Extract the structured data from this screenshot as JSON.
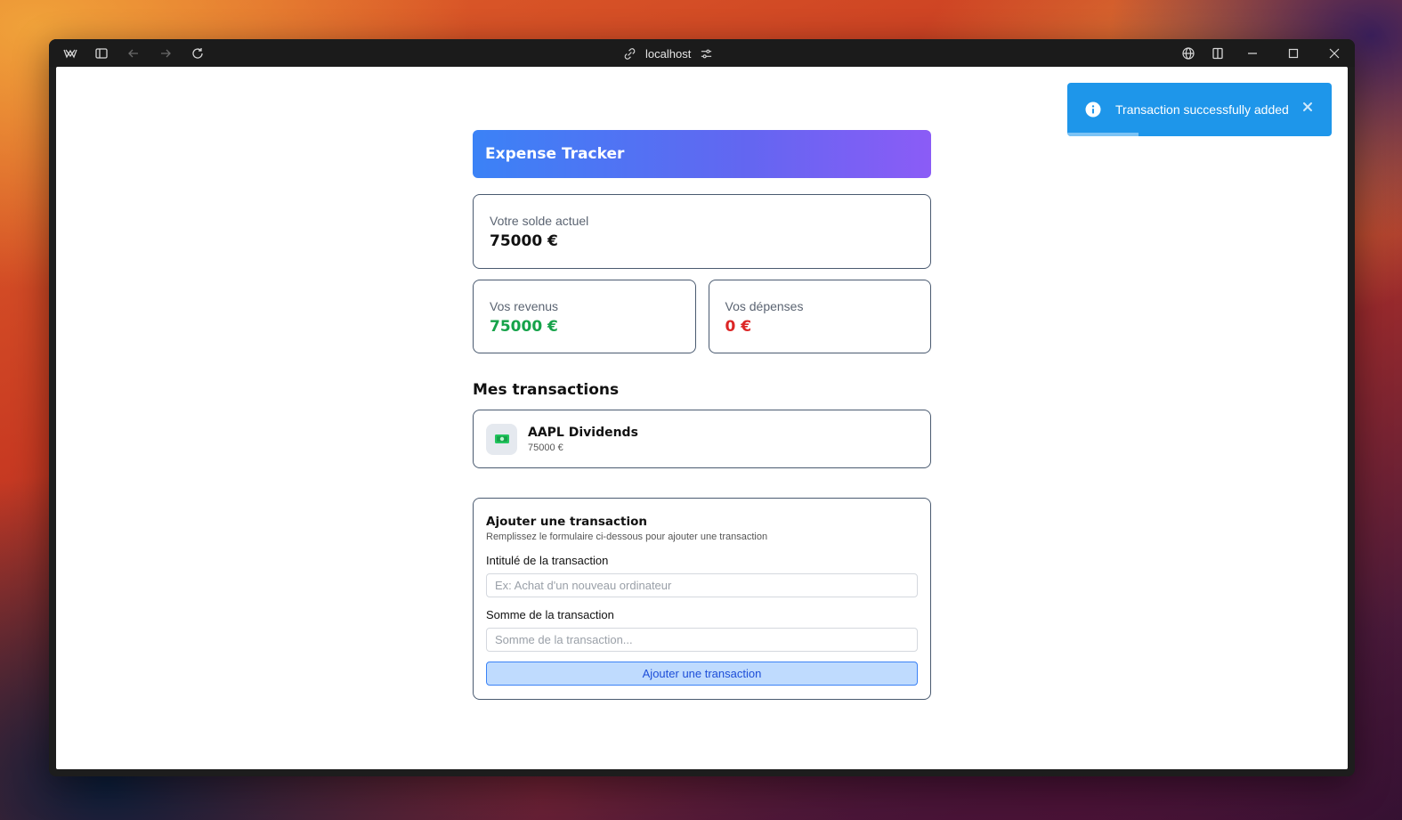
{
  "browser": {
    "url": "localhost"
  },
  "app": {
    "title": "Expense Tracker",
    "balance": {
      "label": "Votre solde actuel",
      "value": "75000 €"
    },
    "income": {
      "label": "Vos revenus",
      "value": "75000 €",
      "color": "#16a34a"
    },
    "expenses": {
      "label": "Vos dépenses",
      "value": "0 €",
      "color": "#dc2626"
    },
    "transactions_title": "Mes transactions",
    "transactions": [
      {
        "icon": "money-icon",
        "name": "AAPL Dividends",
        "amount": "75000 €"
      }
    ],
    "form": {
      "title": "Ajouter une transaction",
      "subtitle": "Remplissez le formulaire ci-dessous pour ajouter une transaction",
      "name_label": "Intitulé de la transaction",
      "name_placeholder": "Ex: Achat d'un nouveau ordinateur",
      "name_value": "",
      "amount_label": "Somme de la transaction",
      "amount_placeholder": "Somme de la transaction...",
      "amount_value": "",
      "submit_label": "Ajouter une transaction"
    }
  },
  "toast": {
    "message": "Transaction successfully added",
    "progress": 0.27,
    "color": "#1e96ea"
  }
}
